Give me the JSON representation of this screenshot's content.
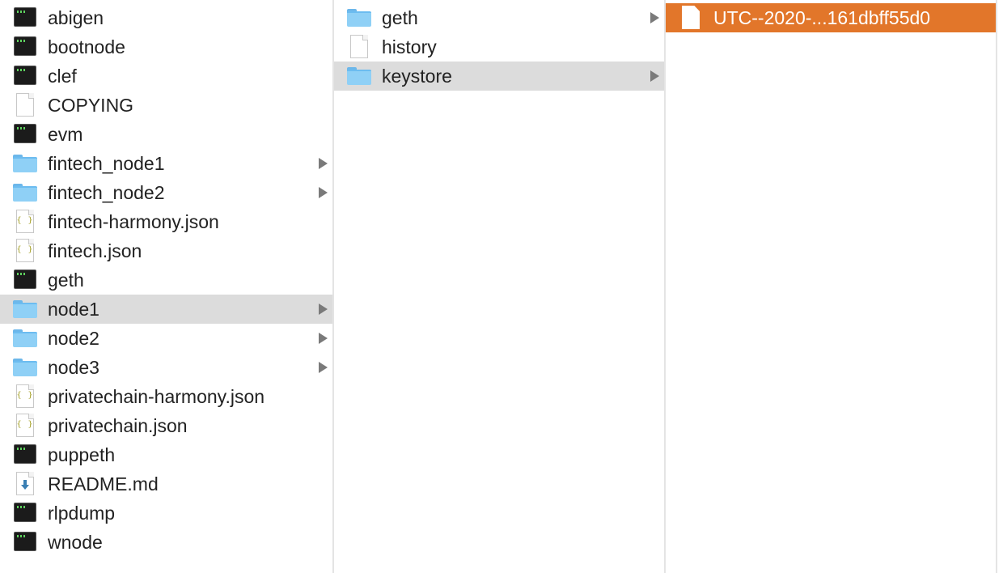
{
  "columns": [
    {
      "items": [
        {
          "label": "abigen",
          "icon": "terminal-icon"
        },
        {
          "label": "bootnode",
          "icon": "terminal-icon"
        },
        {
          "label": "clef",
          "icon": "terminal-icon"
        },
        {
          "label": "COPYING",
          "icon": "document-icon"
        },
        {
          "label": "evm",
          "icon": "terminal-icon"
        },
        {
          "label": "fintech_node1",
          "icon": "folder-icon",
          "expandable": true
        },
        {
          "label": "fintech_node2",
          "icon": "folder-icon",
          "expandable": true
        },
        {
          "label": "fintech-harmony.json",
          "icon": "json-file-icon"
        },
        {
          "label": "fintech.json",
          "icon": "json-file-icon"
        },
        {
          "label": "geth",
          "icon": "terminal-icon"
        },
        {
          "label": "node1",
          "icon": "folder-icon",
          "expandable": true,
          "selected": "inactive"
        },
        {
          "label": "node2",
          "icon": "folder-icon",
          "expandable": true
        },
        {
          "label": "node3",
          "icon": "folder-icon",
          "expandable": true
        },
        {
          "label": "privatechain-harmony.json",
          "icon": "json-file-icon"
        },
        {
          "label": "privatechain.json",
          "icon": "json-file-icon"
        },
        {
          "label": "puppeth",
          "icon": "terminal-icon"
        },
        {
          "label": "README.md",
          "icon": "markdown-file-icon"
        },
        {
          "label": "rlpdump",
          "icon": "terminal-icon"
        },
        {
          "label": "wnode",
          "icon": "terminal-icon"
        }
      ]
    },
    {
      "items": [
        {
          "label": "geth",
          "icon": "folder-icon",
          "expandable": true
        },
        {
          "label": "history",
          "icon": "document-icon"
        },
        {
          "label": "keystore",
          "icon": "folder-icon",
          "expandable": true,
          "selected": "inactive"
        }
      ]
    },
    {
      "items": [
        {
          "label": "UTC--2020-...161dbff55d0",
          "icon": "document-icon",
          "selected": "active"
        }
      ]
    }
  ],
  "colors": {
    "selection_active": "#e2762a",
    "selection_inactive": "#dcdcdc",
    "folder": "#8fd0f6"
  }
}
